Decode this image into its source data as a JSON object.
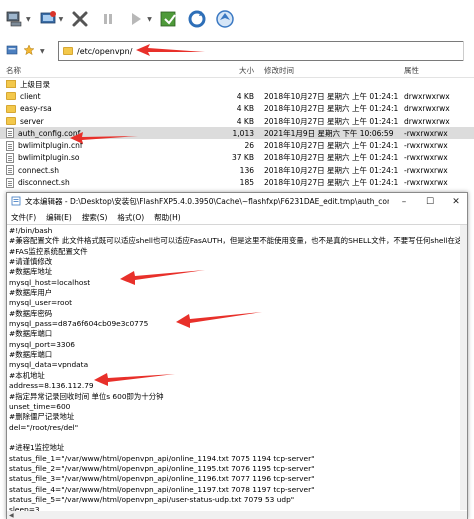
{
  "toolbar": {
    "icons": [
      "connect-icon",
      "quick-connect-icon",
      "disconnect-icon",
      "pause-icon",
      "transfer-icon",
      "queue-icon",
      "refresh-icon",
      "home-icon"
    ]
  },
  "pathbar": {
    "path": "/etc/openvpn/"
  },
  "file_list": {
    "columns": {
      "name": "名称",
      "size": "大小",
      "date": "修改时间",
      "attr": "属性"
    },
    "rows": [
      {
        "type": "up",
        "name": "上级目录",
        "size": "",
        "date": "",
        "attr": ""
      },
      {
        "type": "folder",
        "name": "client",
        "size": "4 KB",
        "date": "2018年10月27日 星期六 上午 01:24:14",
        "attr": "drwxrwxrwx"
      },
      {
        "type": "folder",
        "name": "easy-rsa",
        "size": "4 KB",
        "date": "2018年10月27日 星期六 上午 01:24:14",
        "attr": "drwxrwxrwx"
      },
      {
        "type": "folder",
        "name": "server",
        "size": "4 KB",
        "date": "2018年10月27日 星期六 上午 01:24:14",
        "attr": "drwxrwxrwx"
      },
      {
        "type": "file",
        "name": "auth_config.conf",
        "size": "1,013",
        "date": "2021年1月9日 星期六 下午 10:06:59",
        "attr": "-rwxrwxrwx",
        "selected": true
      },
      {
        "type": "file",
        "name": "bwlimitplugin.cnf",
        "size": "26",
        "date": "2018年10月27日 星期六 上午 01:24:14",
        "attr": "-rwxrwxrwx"
      },
      {
        "type": "file",
        "name": "bwlimitplugin.so",
        "size": "37 KB",
        "date": "2018年10月27日 星期六 上午 01:24:14",
        "attr": "-rwxrwxrwx"
      },
      {
        "type": "file",
        "name": "connect.sh",
        "size": "136",
        "date": "2018年10月27日 星期六 上午 01:24:14",
        "attr": "-rwxrwxrwx"
      },
      {
        "type": "file",
        "name": "disconnect.sh",
        "size": "185",
        "date": "2018年10月27日 星期六 上午 01:24:14",
        "attr": "-rwxrwxrwx"
      }
    ]
  },
  "editor": {
    "title": "文本编辑器 - D:\\Desktop\\安装包\\FlashFXP5.4.0.3950\\Cache\\~flashfxp\\F6231DAE_edit.tmp\\auth_config.conf",
    "menu": [
      "文件(F)",
      "编辑(E)",
      "搜索(S)",
      "格式(O)",
      "帮助(H)"
    ],
    "lines": [
      "#!/bin/bash",
      "#兼容配置文件 此文件格式既可以适应shell也可以适应FasAUTH，但是这里不能使用变量，也不是真的SHELL文件，不要写任何shell在这个文",
      "#FAS监控系统配置文件",
      "#请谨慎修改",
      "#数据库地址",
      "mysql_host=localhost",
      "#数据库用户",
      "mysql_user=root",
      "#数据库密码",
      "mysql_pass=d87a6f604cb09e3c0775",
      "#数据库端口",
      "mysql_port=3306",
      "#数据库端口",
      "mysql_data=vpndata",
      "#本机地址",
      "address=8.136.112.79",
      "#指定异常记录回收时间 单位s 600即为十分钟",
      "unset_time=600",
      "#删除僵尸记录地址",
      "del=\"/root/res/del\"",
      "",
      "#进程1监控地址",
      "status_file_1=\"/var/www/html/openvpn_api/online_1194.txt 7075 1194 tcp-server\"",
      "status_file_2=\"/var/www/html/openvpn_api/online_1195.txt 7076 1195 tcp-server\"",
      "status_file_3=\"/var/www/html/openvpn_api/online_1196.txt 7077 1196 tcp-server\"",
      "status_file_4=\"/var/www/html/openvpn_api/online_1197.txt 7078 1197 tcp-server\"",
      "status_file_5=\"/var/www/html/openvpn_api/user-status-udp.txt 7079 53 udp\"",
      "sleep=3"
    ]
  },
  "colors": {
    "annotation_arrow": "#e8302a",
    "folder": "#f3c84b",
    "selected_row": "#dcdcdc"
  }
}
